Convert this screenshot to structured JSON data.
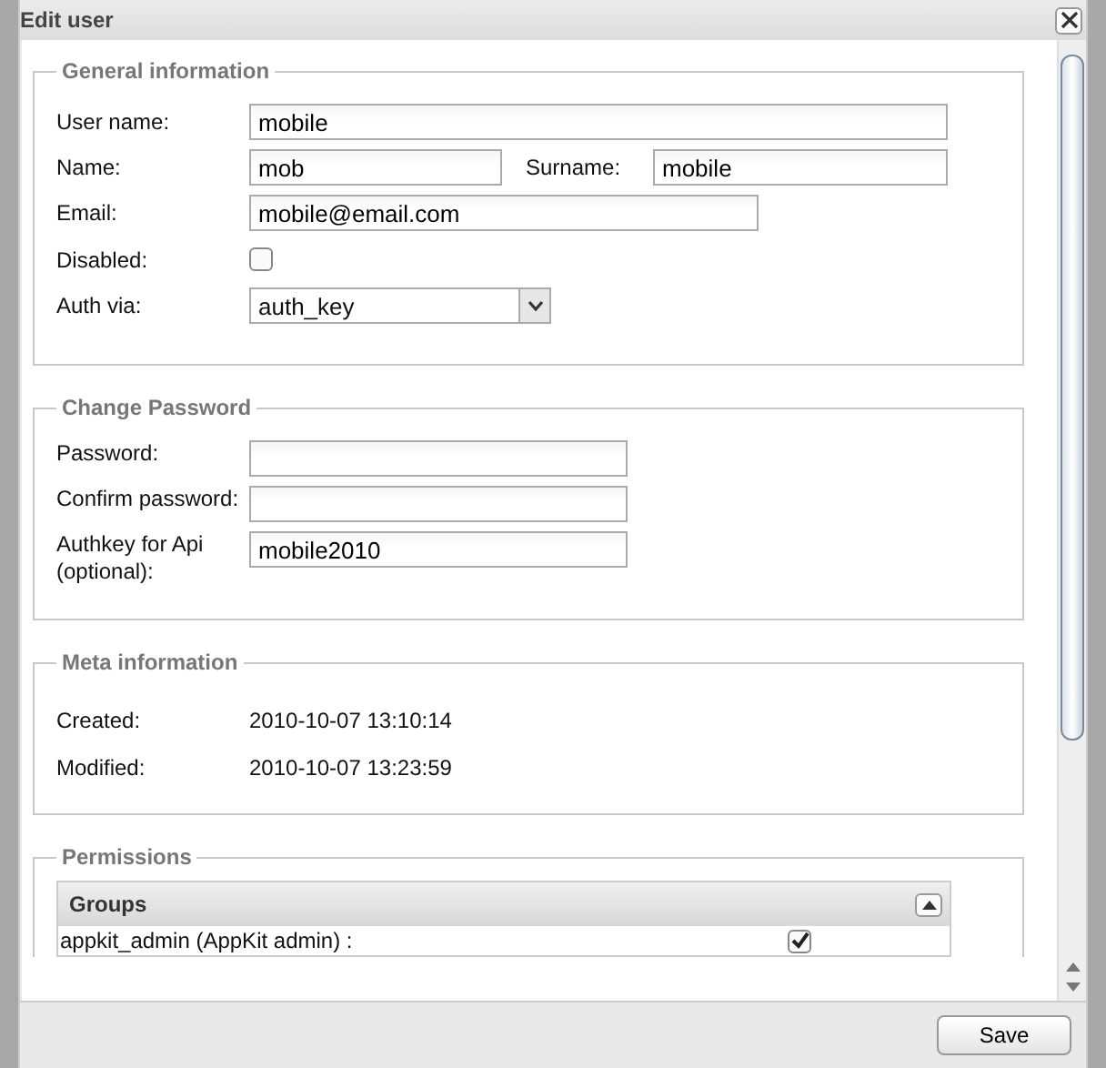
{
  "window": {
    "title": "Edit user"
  },
  "general": {
    "title": "General information",
    "fields": [
      {
        "kind": "text",
        "label": "User name:",
        "value": "mobile"
      },
      {
        "kind": "pair",
        "label": "Name:",
        "value": "mob",
        "label_2": "Surname:",
        "value_2": "mobile"
      },
      {
        "kind": "text",
        "label": "Email:",
        "value": "mobile@email.com"
      },
      {
        "kind": "checkbox",
        "label": "Disabled:",
        "checked": false
      },
      {
        "kind": "select",
        "label": "Auth via:",
        "value": "auth_key"
      }
    ]
  },
  "password": {
    "title": "Change Password",
    "fields": [
      {
        "label": "Password:"
      },
      {
        "label": "Confirm password:"
      },
      {
        "label": "Authkey for Api (optional):",
        "value": "mobile2010"
      }
    ]
  },
  "meta": {
    "title": "Meta information",
    "rows": [
      {
        "label": "Created:",
        "value": "2010-10-07 13:10:14"
      },
      {
        "label": "Modified:",
        "value": "2010-10-07 13:23:59"
      }
    ]
  },
  "permissions": {
    "title": "Permissions",
    "groups": {
      "title": "Groups",
      "expanded": true,
      "rows": [
        {
          "label": "appkit_admin (AppKit admin) :",
          "checked": true
        }
      ]
    }
  },
  "buttons": [
    "Save"
  ]
}
